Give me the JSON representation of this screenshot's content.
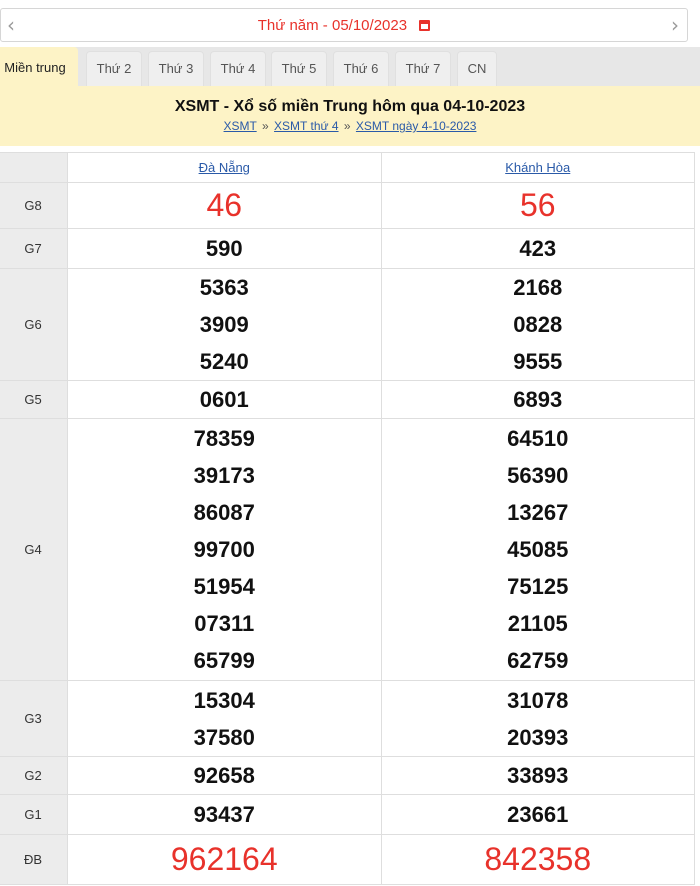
{
  "date_nav": {
    "prev_icon": "chevron-left-icon",
    "next_icon": "chevron-right-icon",
    "day_label": "Thứ năm -",
    "date": "05/10/2023",
    "calendar_icon": "calendar-icon",
    "accent_color": "#e8322b"
  },
  "tabs": [
    "Miền trung",
    "Thứ 2",
    "Thứ 3",
    "Thứ 4",
    "Thứ 5",
    "Thứ 6",
    "Thứ 7",
    "CN"
  ],
  "active_tab": "Miền trung",
  "header": {
    "title": "XSMT - Xổ số miền Trung hôm qua 04-10-2023",
    "breadcrumb": [
      "XSMT",
      "XSMT thứ 4",
      "XSMT ngày 4-10-2023"
    ],
    "separator": "»"
  },
  "provinces": [
    "Đà Nẵng",
    "Khánh Hòa"
  ],
  "prizes": [
    {
      "label": "G8",
      "values": [
        [
          "46"
        ],
        [
          "56"
        ]
      ],
      "highlight": true
    },
    {
      "label": "G7",
      "values": [
        [
          "590"
        ],
        [
          "423"
        ]
      ]
    },
    {
      "label": "G6",
      "values": [
        [
          "5363",
          "3909",
          "5240"
        ],
        [
          "2168",
          "0828",
          "9555"
        ]
      ]
    },
    {
      "label": "G5",
      "values": [
        [
          "0601"
        ],
        [
          "6893"
        ]
      ]
    },
    {
      "label": "G4",
      "values": [
        [
          "78359",
          "39173",
          "86087",
          "99700",
          "51954",
          "07311",
          "65799"
        ],
        [
          "64510",
          "56390",
          "13267",
          "45085",
          "75125",
          "21105",
          "62759"
        ]
      ]
    },
    {
      "label": "G3",
      "values": [
        [
          "15304",
          "37580"
        ],
        [
          "31078",
          "20393"
        ]
      ]
    },
    {
      "label": "G2",
      "values": [
        [
          "92658"
        ],
        [
          "33893"
        ]
      ]
    },
    {
      "label": "G1",
      "values": [
        [
          "93437"
        ],
        [
          "23661"
        ]
      ]
    },
    {
      "label": "ĐB",
      "values": [
        [
          "962164"
        ],
        [
          "842358"
        ]
      ],
      "highlight": true
    }
  ]
}
